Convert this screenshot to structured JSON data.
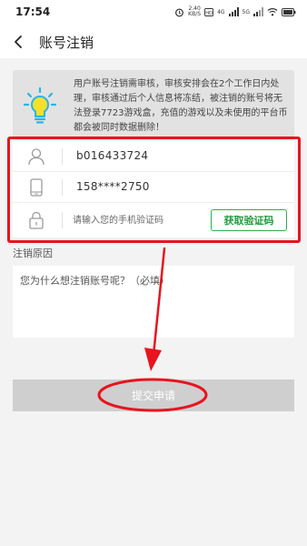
{
  "status_bar": {
    "time": "17:54",
    "speed": "2.40",
    "speed_unit": "KB/S",
    "net_1": "4G",
    "net_2": "5G",
    "icons": [
      "alarm-icon",
      "hd-icon",
      "signal-icon",
      "signal-icon",
      "wifi-icon",
      "battery-icon"
    ]
  },
  "header": {
    "title": "账号注销",
    "back_icon": "chevron-left-icon"
  },
  "notice": {
    "icon": "lightbulb-icon",
    "text": "用户账号注销需审核，审核安排会在2个工作日内处理，审核通过后个人信息将冻结，被注销的账号将无法登录7723游戏盒，充值的游戏以及未使用的平台币都会被同时数据删除！"
  },
  "form": {
    "account": {
      "icon": "user-icon",
      "value": "b016433724"
    },
    "phone": {
      "icon": "phone-icon",
      "value": "158****2750"
    },
    "code": {
      "icon": "lock-icon",
      "placeholder": "请输入您的手机验证码",
      "button_label": "获取验证码"
    }
  },
  "reason": {
    "label": "注销原因",
    "placeholder": "您为什么想注销账号呢？（必填）"
  },
  "submit": {
    "label": "提交申请"
  },
  "colors": {
    "accent_green": "#2fae4e",
    "annotation_red": "#e8141e",
    "button_disabled": "#cfcfcf",
    "page_bg": "#f3f3f3"
  }
}
